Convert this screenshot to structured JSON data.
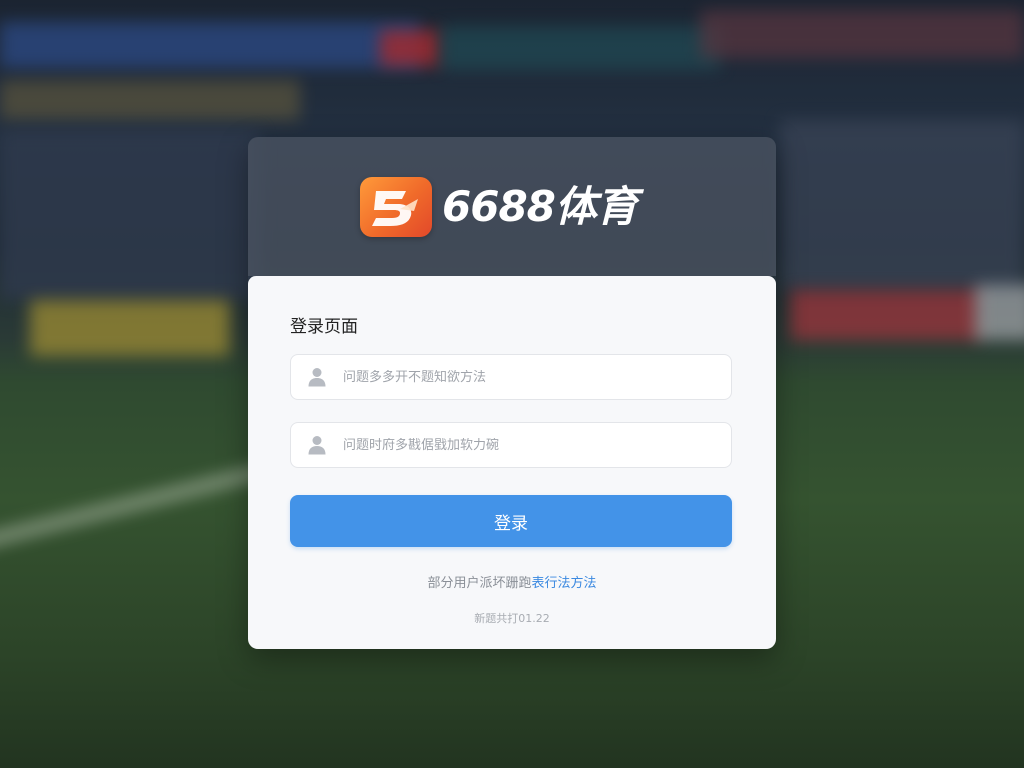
{
  "brand": {
    "name": "6688体育",
    "accent_color": "#f06a2a"
  },
  "form": {
    "title": "登录页面",
    "username": {
      "value": "",
      "placeholder": "问题多多开不题知欲方法",
      "icon": "user-icon"
    },
    "password": {
      "value": "",
      "placeholder": "问题时府多戡倨戥加软力碗",
      "icon": "user-icon"
    },
    "submit_label": "登录",
    "submit_color": "#4393e8"
  },
  "help": {
    "prefix": "部分用户派坏跚跑",
    "link_label": "表行法方法"
  },
  "version": "新题共打01.22"
}
